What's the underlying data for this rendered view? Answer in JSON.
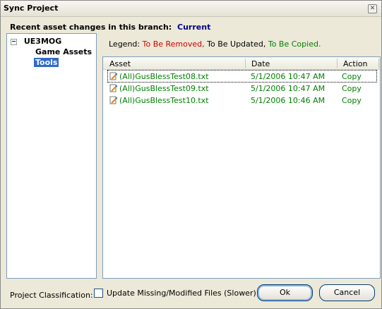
{
  "window": {
    "title": "Sync Project"
  },
  "branch": {
    "label": "Recent asset changes in this branch:",
    "value": "Current"
  },
  "tree": {
    "root": "UE3MOG",
    "root_toggle": "−",
    "items": [
      {
        "label": "Game Assets",
        "selected": false
      },
      {
        "label": "Tools",
        "selected": true
      }
    ]
  },
  "legend": {
    "label": "Legend:",
    "removed": "To Be Removed,",
    "updated": "To Be Updated,",
    "copied": "To Be Copied."
  },
  "list": {
    "columns": [
      "Asset",
      "Date",
      "Action"
    ],
    "rows": [
      {
        "asset": "(All)GusBlessTest08.txt",
        "date": "5/1/2006 10:47 AM",
        "action": "Copy"
      },
      {
        "asset": "(All)GusBlessTest09.txt",
        "date": "5/1/2006 10:47 AM",
        "action": "Copy"
      },
      {
        "asset": "(All)GusBlessTest10.txt",
        "date": "5/1/2006 10:46 AM",
        "action": "Copy"
      }
    ]
  },
  "footer": {
    "classification_label": "Project Classification:",
    "checkbox_label": "Update Missing/Modified Files (Slower)",
    "checkbox_checked": false,
    "ok_label": "Ok",
    "cancel_label": "Cancel"
  },
  "colors": {
    "removed": "#cc0000",
    "copied": "#008000",
    "branch": "#00008b",
    "selection": "#316ac5"
  }
}
